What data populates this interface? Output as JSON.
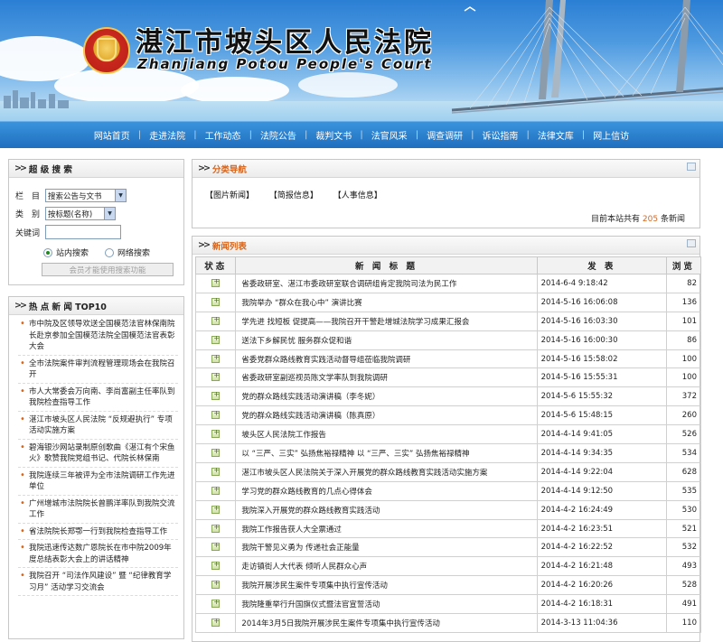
{
  "header": {
    "title": "湛江市坡头区人民法院",
    "subtitle": "Zhanjiang Potou People's Court"
  },
  "nav": {
    "items": [
      "网站首页",
      "走进法院",
      "工作动态",
      "法院公告",
      "裁判文书",
      "法官风采",
      "调查调研",
      "诉讼指南",
      "法律文库",
      "网上信访"
    ]
  },
  "search": {
    "title": "超 级 搜 索",
    "column_label": "栏　目",
    "column_value": "搜索公告与文书",
    "type_label": "类　别",
    "type_value": "按标题(名称)",
    "keyword_label": "关键词",
    "keyword_value": "",
    "radio_site": "站内搜索",
    "radio_web": "网络搜索",
    "member_notice": "会员才能使用搜索功能"
  },
  "hot_news": {
    "title": "热 点 新 闻 TOP10",
    "items": [
      "市中院及区领导欢送全国模范法官林保南院长赴京参加全国模范法院全国模范法官表彰大会",
      "全市法院案件审判流程管理现场会在我院召开",
      "市人大常委会万向南、李尚富副主任率队到我院检查指导工作",
      "湛江市坡头区人民法院 “反规避执行” 专项活动实施方案",
      "碧海银沙网站录制原创歌曲《湛江有个宋鱼火》歌赞我院党组书记、代院长林保南",
      "我院连续三年被评为全市法院调研工作先进单位",
      "广州增城市法院院长曾鹏洋率队到我院交流工作",
      "省法院院长郑鄂一行到我院检查指导工作",
      "我院迅速传达数广恩院长在市中院2009年度总结表彰大会上的讲话精神",
      "我院召开 “司法作风建设” 暨 “纪律教育学习月” 活动学习交流会"
    ]
  },
  "category_nav": {
    "title": "分类导航",
    "links": [
      "【图片新闻】",
      "【简报信息】",
      "【人事信息】"
    ],
    "total_prefix": "目前本站共有",
    "total_count": "205",
    "total_suffix": "条新闻"
  },
  "news": {
    "title": "新闻列表",
    "headers": {
      "status": "状态",
      "title": "新 闻 标 题",
      "date": "发 表",
      "views": "浏览"
    },
    "rows": [
      {
        "title": "省委政研室、湛江市委政研室联合调研组肯定我院司法为民工作",
        "date": "2014-6-4  9:18:42",
        "views": "82"
      },
      {
        "title": "我院举办 “群众在我心中” 演讲比赛",
        "date": "2014-5-16 16:06:08",
        "views": "136"
      },
      {
        "title": "学先进 找短板 促提高——我院召开干警赴增城法院学习成果汇报会",
        "date": "2014-5-16 16:03:30",
        "views": "101"
      },
      {
        "title": "送法下乡解民忧 服务群众促和谐",
        "date": "2014-5-16 16:00:30",
        "views": "86"
      },
      {
        "title": "省委党群众路线教育实践活动督导组莅临我院调研",
        "date": "2014-5-16 15:58:02",
        "views": "100"
      },
      {
        "title": "省委政研室副巡视员陈文学率队到我院调研",
        "date": "2014-5-16 15:55:31",
        "views": "100"
      },
      {
        "title": "党的群众路线实践活动演讲稿（李冬妮）",
        "date": "2014-5-6  15:55:32",
        "views": "372"
      },
      {
        "title": "党的群众路线实践活动演讲稿（陈真原）",
        "date": "2014-5-6  15:48:15",
        "views": "260"
      },
      {
        "title": "坡头区人民法院工作报告",
        "date": "2014-4-14  9:41:05",
        "views": "526"
      },
      {
        "title": "以 “三严、三实” 弘扬焦裕禄精神 以 “三严、三实” 弘扬焦裕禄精神",
        "date": "2014-4-14  9:34:35",
        "views": "534"
      },
      {
        "title": "湛江市坡头区人民法院关于深入开展党的群众路线教育实践活动实施方案",
        "date": "2014-4-14  9:22:04",
        "views": "628"
      },
      {
        "title": "学习党的群众路线教育的几点心得体会",
        "date": "2014-4-14  9:12:50",
        "views": "535"
      },
      {
        "title": "我院深入开展党的群众路线教育实践活动",
        "date": "2014-4-2  16:24:49",
        "views": "530"
      },
      {
        "title": "我院工作报告获人大全票通过",
        "date": "2014-4-2  16:23:51",
        "views": "521"
      },
      {
        "title": "我院干警见义勇为 传递社会正能量",
        "date": "2014-4-2  16:22:52",
        "views": "532"
      },
      {
        "title": "走访镇街人大代表 倾听人民群众心声",
        "date": "2014-4-2  16:21:48",
        "views": "493"
      },
      {
        "title": "我院开展涉民生案件专项集中执行宣传活动",
        "date": "2014-4-2  16:20:26",
        "views": "528"
      },
      {
        "title": "我院隆重举行升国旗仪式暨法官宣誓活动",
        "date": "2014-4-2  16:18:31",
        "views": "491"
      },
      {
        "title": "2014年3月5日我院开展涉民生案件专项集中执行宣传活动",
        "date": "2014-3-13 11:04:36",
        "views": "110"
      }
    ]
  }
}
